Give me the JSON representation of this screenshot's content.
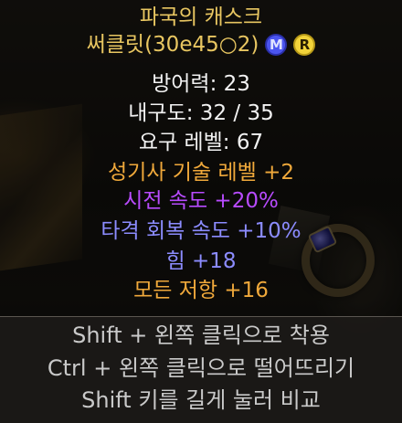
{
  "item": {
    "name": "파국의 캐스크",
    "base_name": "써클릿(30e45○2)",
    "badges": {
      "magic": "M",
      "rare": "R"
    },
    "stats": {
      "defense": "방어력: 23",
      "durability": "내구도: 32 / 35",
      "level_req": "요구 레벨: 67"
    },
    "mods": [
      "성기사 기술 레벨 +2",
      "시전 속도 +20%",
      "타격 회복 속도 +10%",
      "힘 +18",
      "모든 저항 +16"
    ]
  },
  "hints": [
    "Shift + 왼쪽 클릭으로 착용",
    "Ctrl + 왼쪽 클릭으로 떨어뜨리기",
    "Shift 키를 길게 눌러 비교"
  ],
  "colors": {
    "item_name": "#e8c661",
    "stat_white": "#f2f2f2",
    "skill_mod": "#f0a93b",
    "fcr_mod": "#b84bff",
    "magic_mod": "#8c8cff",
    "hint_text": "#c9c9c9",
    "badge_magic": "#4b55f0",
    "badge_rare": "#f2d33a"
  }
}
